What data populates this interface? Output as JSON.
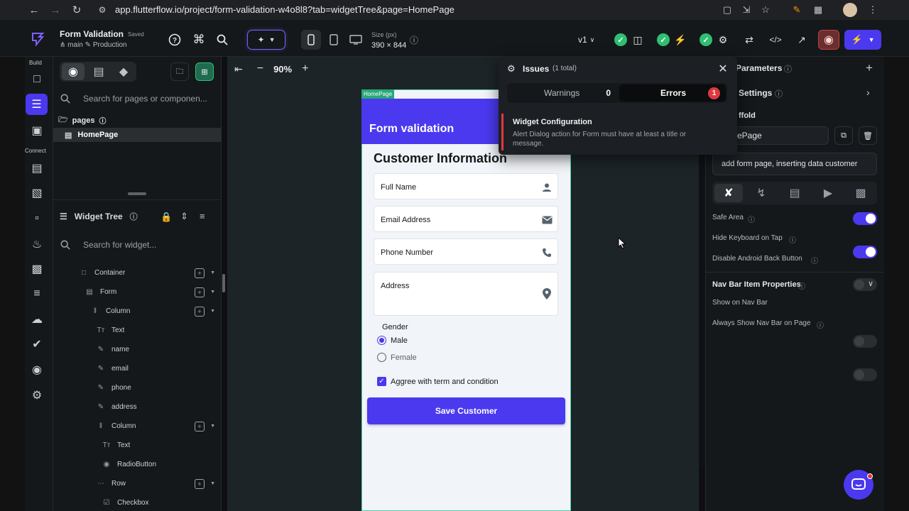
{
  "browser": {
    "url": "app.flutterflow.io/project/form-validation-w4o8l8?tab=widgetTree&page=HomePage"
  },
  "header": {
    "project_title": "Form Validation",
    "saved": "Saved",
    "branch": "main",
    "environment": "Production",
    "size_label": "Size (px)",
    "size_value": "390 × 844",
    "version": "v1"
  },
  "rail": {
    "build_label": "Build",
    "connect_label": "Connect"
  },
  "left_panel": {
    "search_pages_placeholder": "Search for pages or componen...",
    "pages_folder": "pages",
    "homepage": "HomePage",
    "widget_tree_title": "Widget Tree",
    "search_widget_placeholder": "Search for widget...",
    "tree": [
      {
        "label": "Container",
        "icon": "container-icon",
        "level": 1,
        "add": true
      },
      {
        "label": "Form",
        "icon": "form-icon",
        "level": 2,
        "add": true
      },
      {
        "label": "Column",
        "icon": "column-icon",
        "level": 3,
        "add": true
      },
      {
        "label": "Text",
        "icon": "text-icon",
        "level": 4,
        "add": false
      },
      {
        "label": "name",
        "icon": "textfield-icon",
        "level": 4,
        "add": false
      },
      {
        "label": "email",
        "icon": "textfield-icon",
        "level": 4,
        "add": false
      },
      {
        "label": "phone",
        "icon": "textfield-icon",
        "level": 4,
        "add": false
      },
      {
        "label": "address",
        "icon": "textfield-icon",
        "level": 4,
        "add": false
      },
      {
        "label": "Column",
        "icon": "column-icon",
        "level": 4,
        "add": true
      },
      {
        "label": "Text",
        "icon": "text-icon",
        "level": 5,
        "add": false
      },
      {
        "label": "RadioButton",
        "icon": "radio-icon",
        "level": 5,
        "add": false
      },
      {
        "label": "Row",
        "icon": "row-icon",
        "level": 4,
        "add": true
      },
      {
        "label": "Checkbox",
        "icon": "checkbox-icon",
        "level": 5,
        "add": false
      }
    ]
  },
  "canvas": {
    "zoom": "90%",
    "page_tag": "HomePage",
    "appbar_title": "Form validation",
    "form_heading": "Customer Information",
    "fields": [
      {
        "label": "Full Name",
        "icon": "person-icon"
      },
      {
        "label": "Email Address",
        "icon": "mail-icon"
      },
      {
        "label": "Phone Number",
        "icon": "phone-icon"
      },
      {
        "label": "Address",
        "icon": "location-icon"
      }
    ],
    "gender_label": "Gender",
    "gender_options": [
      {
        "label": "Male",
        "selected": true
      },
      {
        "label": "Female",
        "selected": false
      }
    ],
    "terms_label": "Aggree with term and condition",
    "terms_checked": true,
    "save_button": "Save Customer"
  },
  "issues": {
    "title": "Issues",
    "count": "(1 total)",
    "warnings_label": "Warnings",
    "warnings_count": "0",
    "errors_label": "Errors",
    "errors_count": "1",
    "item_title": "Widget Configuration",
    "item_message": "Alert Dialog action for Form must have at least a title or message."
  },
  "right_panel": {
    "parameters_title": "Parameters",
    "settings_title": "Settings",
    "scaffold_title": "ffold",
    "page_name": "ePage",
    "description": "add form page, inserting data customer",
    "rows": [
      {
        "label": "Safe Area",
        "on": true
      },
      {
        "label": "Hide Keyboard on Tap",
        "on": true
      },
      {
        "label": "Disable Android Back Button",
        "on": false
      }
    ],
    "nav_section_title": "Nav Bar Item Properties",
    "nav_rows": [
      {
        "label": "Show on Nav Bar",
        "on": false
      },
      {
        "label": "Always Show Nav Bar on Page",
        "on": false
      }
    ]
  },
  "colors": {
    "accent": "#4b39ef",
    "success": "#2fbf71",
    "error": "#e0383e",
    "page_tag": "#28a879"
  }
}
